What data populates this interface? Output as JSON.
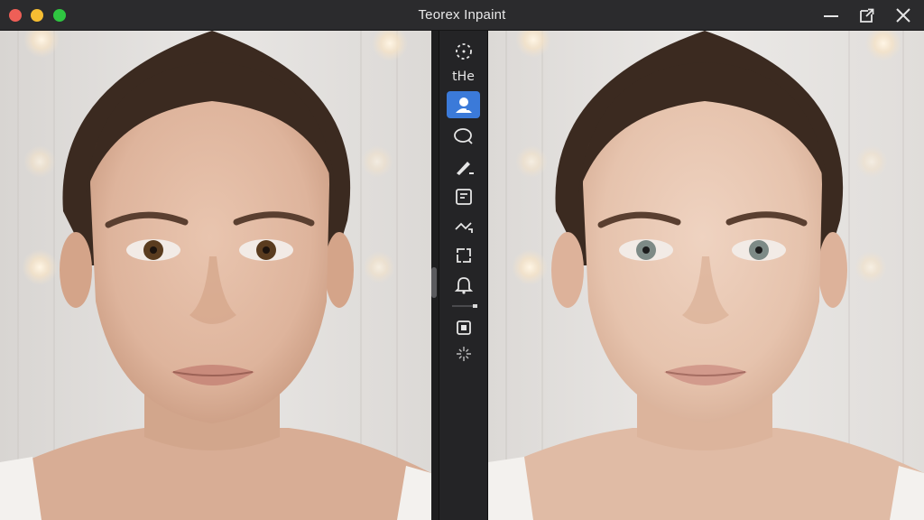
{
  "window": {
    "title": "Teorex Inpaint",
    "traffic_lights": {
      "close": "#ee5f57",
      "minimize": "#f5bd32",
      "zoom": "#2fc641"
    },
    "controls": [
      "minimize-icon",
      "restore-icon",
      "close-icon"
    ]
  },
  "toolbar": {
    "active_color": "#3b7ad9",
    "tools": [
      {
        "icon": "selection-icon",
        "active": false
      },
      {
        "icon": "text-icon",
        "label": "tHe",
        "active": false
      },
      {
        "icon": "portrait-retouch-icon",
        "active": true
      },
      {
        "icon": "lasso-icon",
        "active": false
      },
      {
        "icon": "brush-icon",
        "active": false
      },
      {
        "icon": "note-icon",
        "active": false
      },
      {
        "icon": "line-remover-icon",
        "active": false
      },
      {
        "icon": "clone-stamp-icon",
        "active": false
      },
      {
        "icon": "bell-icon",
        "active": false
      },
      {
        "icon": "brush-size-slider",
        "active": false
      },
      {
        "icon": "preview-icon",
        "active": false
      },
      {
        "icon": "sparkle-icon",
        "active": false
      }
    ]
  },
  "panes": {
    "left": {
      "name": "original-photo",
      "eye_color": "#5a3c1f"
    },
    "right": {
      "name": "retouched-photo",
      "eye_color": "#7d8a86"
    }
  }
}
